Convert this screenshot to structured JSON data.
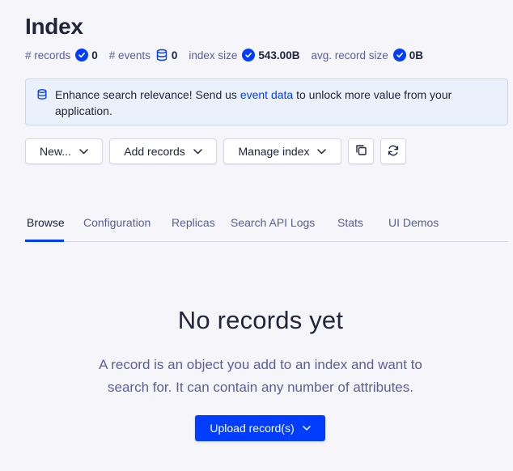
{
  "header": {
    "title": "Index"
  },
  "stats": [
    {
      "label": "# records",
      "value": "0",
      "icon": "check-circle-icon"
    },
    {
      "label": "# events",
      "value": "0",
      "icon": "database-icon"
    },
    {
      "label": "index size",
      "value": "543.00B",
      "icon": "check-circle-icon"
    },
    {
      "label": "avg. record size",
      "value": "0B",
      "icon": "check-circle-icon"
    }
  ],
  "banner": {
    "icon": "database-icon",
    "text_before": "Enhance search relevance! Send us ",
    "link": "event data",
    "text_after": " to unlock more value from your application."
  },
  "toolbar": {
    "new_label": "New...",
    "add_records_label": "Add records",
    "manage_index_label": "Manage index",
    "copy_icon": "copy-icon",
    "refresh_icon": "refresh-icon"
  },
  "tabs": [
    {
      "label": "Browse",
      "active": true
    },
    {
      "label": "Configuration",
      "active": false
    },
    {
      "label": "Replicas",
      "active": false
    },
    {
      "label": "Search API Logs",
      "active": false
    },
    {
      "label": "Stats",
      "active": false
    },
    {
      "label": "UI Demos",
      "active": false
    }
  ],
  "empty_state": {
    "title": "No records yet",
    "description": "A record is an object you add to an index and want to search for. It can contain any number of attributes.",
    "upload_label": "Upload record(s)"
  },
  "colors": {
    "accent": "#003dff",
    "background": "#f5f5fa",
    "banner_bg": "#eaf1fd",
    "text_primary": "#21243d",
    "text_secondary": "#5a5e9a"
  }
}
